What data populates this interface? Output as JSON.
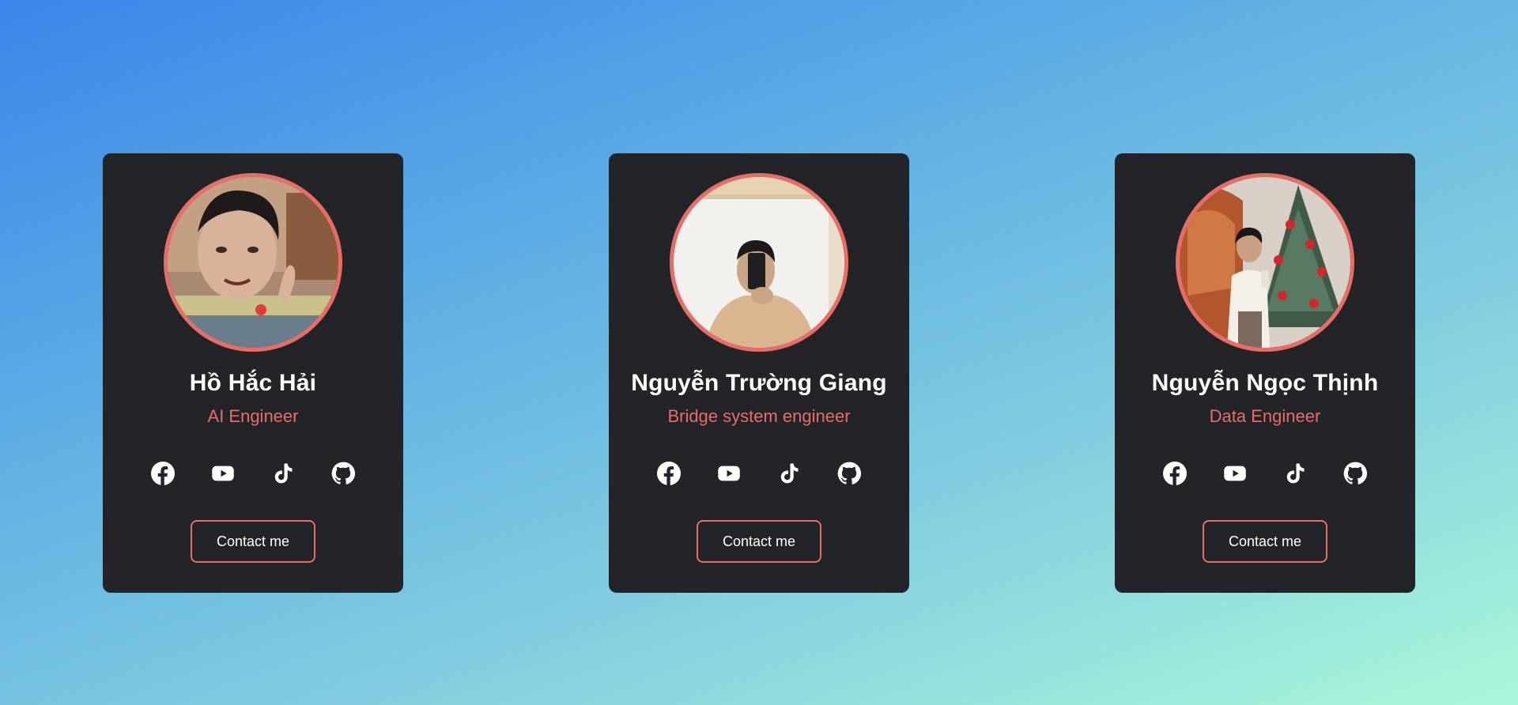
{
  "colors": {
    "card_bg": "#232427",
    "accent": "#ea6c66",
    "text": "#ffffff"
  },
  "cards": [
    {
      "name": "Hồ Hắc Hải",
      "role": "AI Engineer",
      "contact_label": "Contact me",
      "socials": [
        "facebook-icon",
        "youtube-icon",
        "tiktok-icon",
        "github-icon"
      ]
    },
    {
      "name": "Nguyễn Trường Giang",
      "role": "Bridge system engineer",
      "contact_label": "Contact me",
      "socials": [
        "facebook-icon",
        "youtube-icon",
        "tiktok-icon",
        "github-icon"
      ]
    },
    {
      "name": "Nguyễn Ngọc Thịnh",
      "role": "Data Engineer",
      "contact_label": "Contact me",
      "socials": [
        "facebook-icon",
        "youtube-icon",
        "tiktok-icon",
        "github-icon"
      ]
    }
  ]
}
